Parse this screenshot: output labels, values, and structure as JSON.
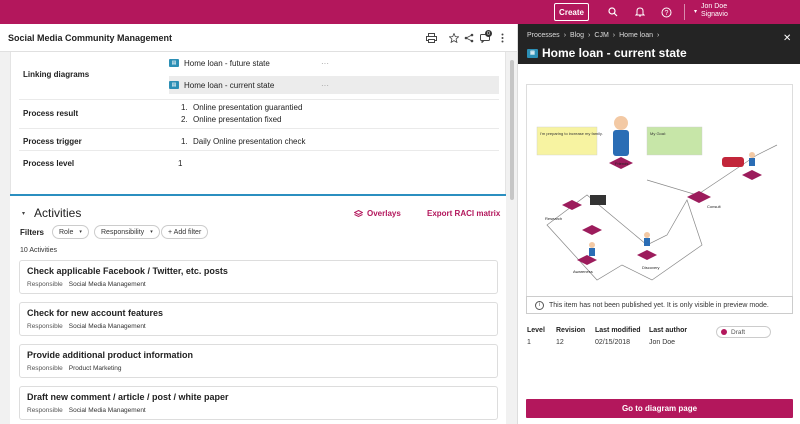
{
  "topbar": {
    "create_label": "Create",
    "user_name": "Jon Doe",
    "user_org": "Signavio",
    "brand_color": "#b3175c",
    "icons": [
      "search-icon",
      "bell-icon",
      "help-icon",
      "user-icon"
    ]
  },
  "page": {
    "title": "Social Media Community Management",
    "notification_count": "0"
  },
  "properties": {
    "linking_label": "Linking diagrams",
    "linking_items": [
      "Home loan - future state",
      "Home loan - current state"
    ],
    "result_label": "Process result",
    "result_items": [
      {
        "num": "1.",
        "text": "Online presentation guarantied"
      },
      {
        "num": "2.",
        "text": "Online presentation fixed"
      }
    ],
    "trigger_label": "Process trigger",
    "trigger_items": [
      {
        "num": "1.",
        "text": "Daily Online presentation check"
      }
    ],
    "level_label": "Process level",
    "level_value": "1"
  },
  "activities": {
    "title": "Activities",
    "overlays_label": "Overlays",
    "export_label": "Export RACI matrix",
    "filters_label": "Filters",
    "filter_role": "Role",
    "filter_responsibility": "Responsibility",
    "add_filter": "+ Add filter",
    "count_label": "10 Activities",
    "items": [
      {
        "name": "Check applicable Facebook / Twitter, etc. posts",
        "resp_label": "Responsible",
        "owner": "Social Media Management"
      },
      {
        "name": "Check for new account features",
        "resp_label": "Responsible",
        "owner": "Social Media Management"
      },
      {
        "name": "Provide additional product information",
        "resp_label": "Responsible",
        "owner": "Product Marketing"
      },
      {
        "name": "Draft new comment / article / post / white paper",
        "resp_label": "Responsible",
        "owner": "Social Media Management"
      }
    ]
  },
  "panel": {
    "breadcrumb": [
      "Processes",
      "›",
      "Blog",
      "›",
      "CJM",
      "›",
      "Home loan",
      "›"
    ],
    "title": "Home loan - current state",
    "banner_text": "This item has not been published yet. It is only visible in preview mode.",
    "meta": {
      "level_h": "Level",
      "level_v": "1",
      "revision_h": "Revision",
      "revision_v": "12",
      "modified_h": "Last modified",
      "modified_v": "02/15/2018",
      "author_h": "Last author",
      "author_v": "Jon Doe",
      "status": "Draft"
    },
    "go_button": "Go to diagram page",
    "diagram_labels": {
      "consult": "Consult",
      "research": "Research",
      "awareness": "Awareness",
      "discovery": "Discovery",
      "friends": "Friends",
      "bubble_1": "I'm preparing to increase my family.",
      "bubble_2": "My Goal:"
    }
  }
}
